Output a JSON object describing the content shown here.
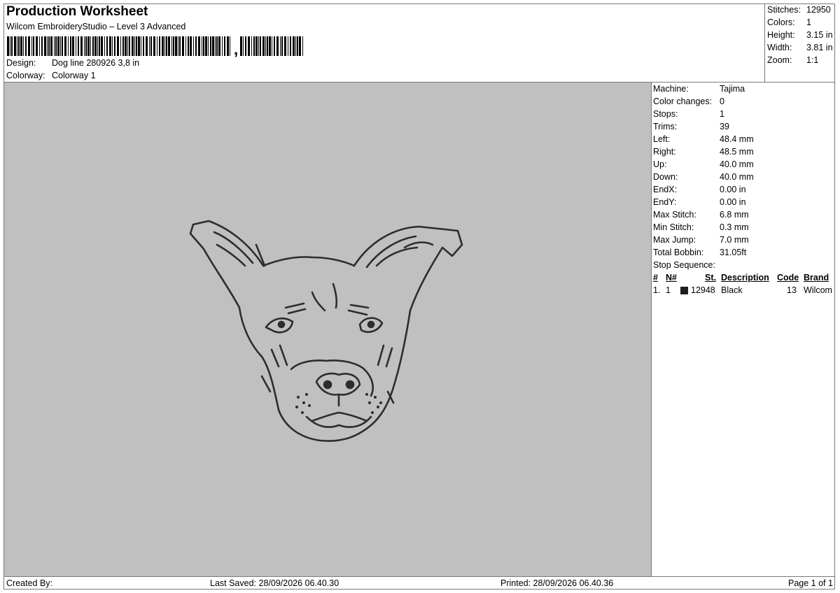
{
  "header": {
    "title": "Production Worksheet",
    "subtitle": "Wilcom EmbroideryStudio – Level 3 Advanced",
    "barcode_text": ","
  },
  "design": {
    "label": "Design:",
    "value": "Dog line 280926 3,8 in"
  },
  "colorway": {
    "label": "Colorway:",
    "value": "Colorway 1"
  },
  "stats": [
    {
      "label": "Stitches:",
      "value": "12950"
    },
    {
      "label": "Colors:",
      "value": "1"
    },
    {
      "label": "Height:",
      "value": "3.15 in"
    },
    {
      "label": "Width:",
      "value": "3.81 in"
    },
    {
      "label": "Zoom:",
      "value": "1:1"
    }
  ],
  "info": [
    {
      "label": "Machine:",
      "value": "Tajima"
    },
    {
      "label": "Color changes:",
      "value": "0"
    },
    {
      "label": "Stops:",
      "value": "1"
    },
    {
      "label": "Trims:",
      "value": "39"
    },
    {
      "label": "Left:",
      "value": "48.4 mm"
    },
    {
      "label": "Right:",
      "value": "48.5 mm"
    },
    {
      "label": "Up:",
      "value": "40.0 mm"
    },
    {
      "label": "Down:",
      "value": "40.0 mm"
    },
    {
      "label": "EndX:",
      "value": "0.00 in"
    },
    {
      "label": "EndY:",
      "value": "0.00 in"
    },
    {
      "label": "Max Stitch:",
      "value": "6.8 mm"
    },
    {
      "label": "Min Stitch:",
      "value": "0.3 mm"
    },
    {
      "label": "Max Jump:",
      "value": "7.0 mm"
    },
    {
      "label": "Total Bobbin:",
      "value": "31.05ft"
    },
    {
      "label": "Stop Sequence:",
      "value": ""
    }
  ],
  "stop_sequence": {
    "headers": {
      "num": "#",
      "needle": "N#",
      "stitches": "St.",
      "description": "Description",
      "code": "Code",
      "brand": "Brand"
    },
    "rows": [
      {
        "num": "1.",
        "needle": "1",
        "color": "#1e1e1e",
        "stitches": "12948",
        "description": "Black",
        "code": "13",
        "brand": "Wilcom"
      }
    ]
  },
  "canvas": {
    "background": "#c0c0c0",
    "thread_color": "#2f2d29"
  },
  "footer": {
    "created_by": "Created By:",
    "last_saved": "Last Saved: 28/09/2026 06.40.30",
    "printed": "Printed: 28/09/2026 06.40.36",
    "page": "Page 1 of 1"
  }
}
